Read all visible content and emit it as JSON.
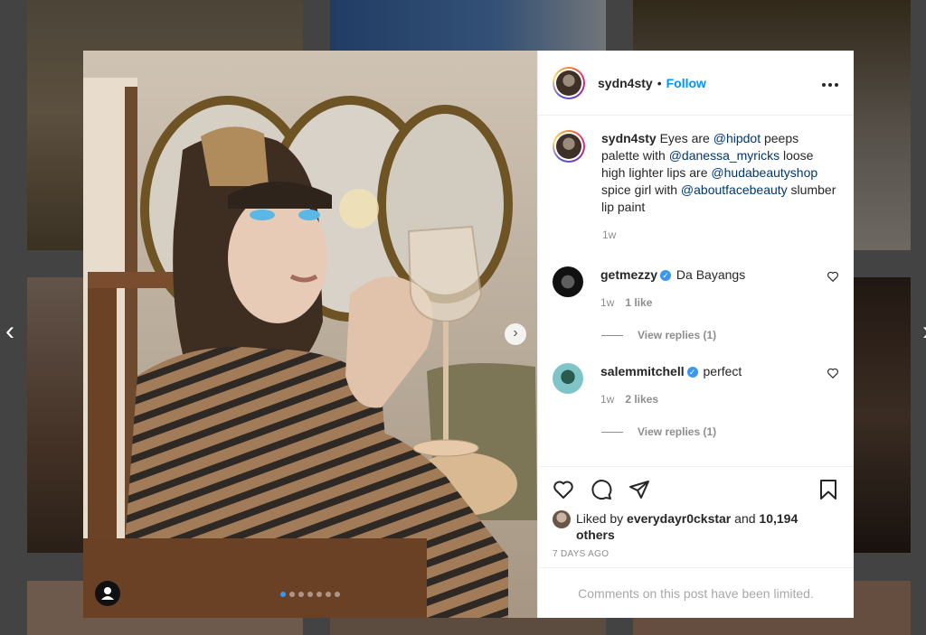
{
  "post": {
    "username": "sydn4sty",
    "follow_label": "Follow",
    "dot": "•",
    "more_icon": "more-horizontal-icon"
  },
  "caption": {
    "username": "sydn4sty",
    "t1": " Eyes are ",
    "m1": "@hipdot",
    "t2": " peeps palette with ",
    "m2": "@danessa_myricks",
    "t3": " loose high lighter lips are ",
    "m3": "@hudabeautyshop",
    "t4": " spice girl with ",
    "m4": "@aboutfacebeauty",
    "t5": " slumber lip paint",
    "time": "1w"
  },
  "comments": [
    {
      "username": "getmezzy",
      "verified": true,
      "text": "Da Bayangs",
      "time": "1w",
      "likes": "1 like",
      "replies": "View replies (1)"
    },
    {
      "username": "salemmitchell",
      "verified": true,
      "text": "perfect",
      "time": "1w",
      "likes": "2 likes",
      "replies": "View replies (1)"
    }
  ],
  "likes": {
    "prefix": "Liked by ",
    "user": "everydayr0ckstar",
    "mid": " and ",
    "others": "10,194 others"
  },
  "posted": "7 DAYS AGO",
  "comments_limited": "Comments on this post have been limited.",
  "carousel": {
    "count": 7,
    "active_index": 0
  },
  "colors": {
    "link": "#0095f6",
    "mention": "#00376b",
    "muted": "#8e8e8e"
  }
}
